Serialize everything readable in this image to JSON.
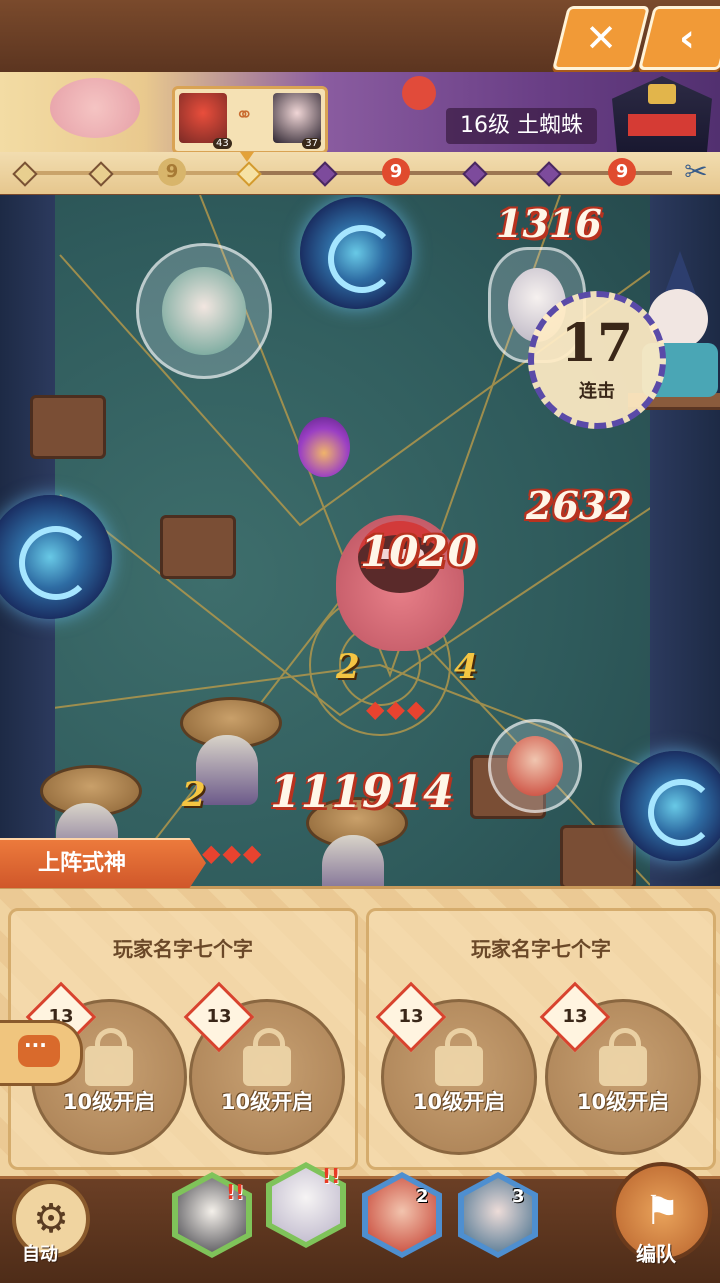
{
  "header": {
    "close_icon": "close-icon",
    "back_icon": "back-arrow-icon",
    "boss_label": "16级 土蜘蛛",
    "player_levels": [
      "43",
      "37"
    ],
    "colors": {
      "button": "#f19a37",
      "accent_red": "#e04b2e"
    }
  },
  "progress": {
    "nodes": [
      "done",
      "done",
      "spiral-done",
      "current",
      "todo",
      "spiral",
      "todo",
      "todo",
      "spiral"
    ],
    "spiral_glyph": "9",
    "end_icon": "scissors-icon"
  },
  "battle": {
    "combo": {
      "count": "17",
      "label": "连击"
    },
    "damage_numbers": [
      "1316",
      "2632",
      "1020",
      "111914"
    ],
    "sub_numbers": [
      "2",
      "4",
      "2"
    ]
  },
  "deploy": {
    "tab_label": "上阵式神",
    "teams": [
      {
        "name": "玩家名字七个字",
        "slots": [
          {
            "badge": "13",
            "text": "10级开启"
          },
          {
            "badge": "13",
            "text": "10级开启"
          }
        ]
      },
      {
        "name": "玩家名字七个字",
        "slots": [
          {
            "badge": "13",
            "text": "10级开启"
          },
          {
            "badge": "13",
            "text": "10级开启"
          }
        ]
      }
    ],
    "chat_icon": "chat-bubble-icon"
  },
  "bottom": {
    "auto_label": "自动",
    "edit_label": "编队",
    "heroes": [
      {
        "alert": "!!",
        "count": ""
      },
      {
        "alert": "!!",
        "count": ""
      },
      {
        "alert": "",
        "count": "2"
      },
      {
        "alert": "",
        "count": "3"
      }
    ]
  }
}
